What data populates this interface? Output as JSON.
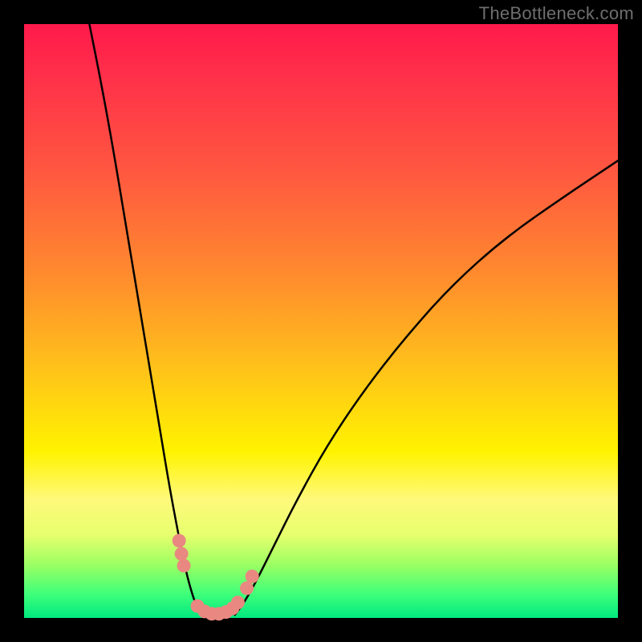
{
  "watermark": "TheBottleneck.com",
  "chart_data": {
    "type": "line",
    "title": "",
    "xlabel": "",
    "ylabel": "",
    "xlim": [
      0,
      100
    ],
    "ylim": [
      0,
      100
    ],
    "series": [
      {
        "name": "left-curve",
        "x": [
          11,
          13,
          15,
          17,
          19,
          21,
          23,
          24.5,
          26,
          27,
          28,
          29,
          29.8
        ],
        "y": [
          100,
          90,
          79,
          67,
          55,
          43,
          31,
          22,
          14,
          9,
          5,
          2,
          0.5
        ]
      },
      {
        "name": "right-curve",
        "x": [
          35.5,
          37,
          39,
          42,
          46,
          51,
          57,
          64,
          72,
          81,
          91,
          100
        ],
        "y": [
          0.5,
          2.5,
          6,
          12,
          20,
          29,
          38,
          47,
          56,
          64,
          71,
          77
        ]
      }
    ],
    "markers": {
      "name": "pink-dots",
      "color": "#e98880",
      "points": [
        {
          "x": 26.1,
          "y": 13.0
        },
        {
          "x": 26.5,
          "y": 10.8
        },
        {
          "x": 26.9,
          "y": 8.8
        },
        {
          "x": 29.2,
          "y": 2.0
        },
        {
          "x": 30.4,
          "y": 1.1
        },
        {
          "x": 31.6,
          "y": 0.7
        },
        {
          "x": 32.8,
          "y": 0.7
        },
        {
          "x": 34.0,
          "y": 1.0
        },
        {
          "x": 35.1,
          "y": 1.6
        },
        {
          "x": 36.0,
          "y": 2.6
        },
        {
          "x": 37.5,
          "y": 5.0
        },
        {
          "x": 38.4,
          "y": 7.0
        }
      ]
    }
  }
}
